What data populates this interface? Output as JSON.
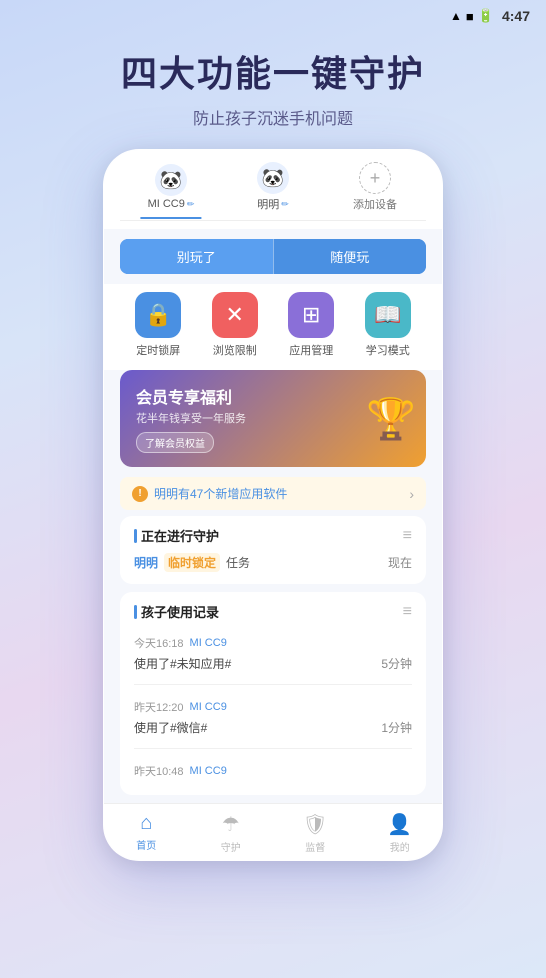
{
  "statusBar": {
    "time": "4:47",
    "signal": "▲",
    "wifi": "WiFi",
    "battery": "🔋"
  },
  "header": {
    "title": "四大功能一键守护",
    "subtitle": "防止孩子沉迷手机问题"
  },
  "phone": {
    "devices": [
      {
        "name": "MI CC9",
        "emoji": "🐼",
        "active": true
      },
      {
        "name": "明明",
        "emoji": "🐼",
        "active": false
      }
    ],
    "addDevice": "添加设备",
    "controlButtons": {
      "left": "别玩了",
      "right": "随便玩"
    },
    "features": [
      {
        "label": "定时锁屏",
        "icon": "🔒",
        "color": "blue"
      },
      {
        "label": "浏览限制",
        "icon": "✕",
        "color": "red"
      },
      {
        "label": "应用管理",
        "icon": "⊞",
        "color": "purple"
      },
      {
        "label": "学习模式",
        "icon": "📖",
        "color": "teal"
      }
    ],
    "banner": {
      "title": "会员专享福利",
      "subtitle": "花半年钱享受一年服务",
      "btnLabel": "了解会员权益",
      "figure": "🏆"
    },
    "notification": {
      "text": "明明有47个新增应用软件"
    },
    "guardingSection": {
      "title": "正在进行守护",
      "content": {
        "device": "明明",
        "tag": "临时锁定",
        "text": "任务",
        "right": "现在"
      }
    },
    "usageSection": {
      "title": "孩子使用记录",
      "records": [
        {
          "time": "今天16:18",
          "device": "MI CC9",
          "app": "使用了#未知应用#",
          "duration": "5分钟"
        },
        {
          "time": "昨天12:20",
          "device": "MI CC9",
          "app": "使用了#微信#",
          "duration": "1分钟"
        },
        {
          "time": "昨天10:48",
          "device": "MI CC9",
          "app": "",
          "duration": ""
        }
      ]
    },
    "bottomNav": [
      {
        "label": "首页",
        "icon": "⌂",
        "active": true
      },
      {
        "label": "守护",
        "icon": "☂",
        "active": false
      },
      {
        "label": "监督",
        "icon": "🛡",
        "active": false
      },
      {
        "label": "我的",
        "icon": "👤",
        "active": false
      }
    ]
  }
}
